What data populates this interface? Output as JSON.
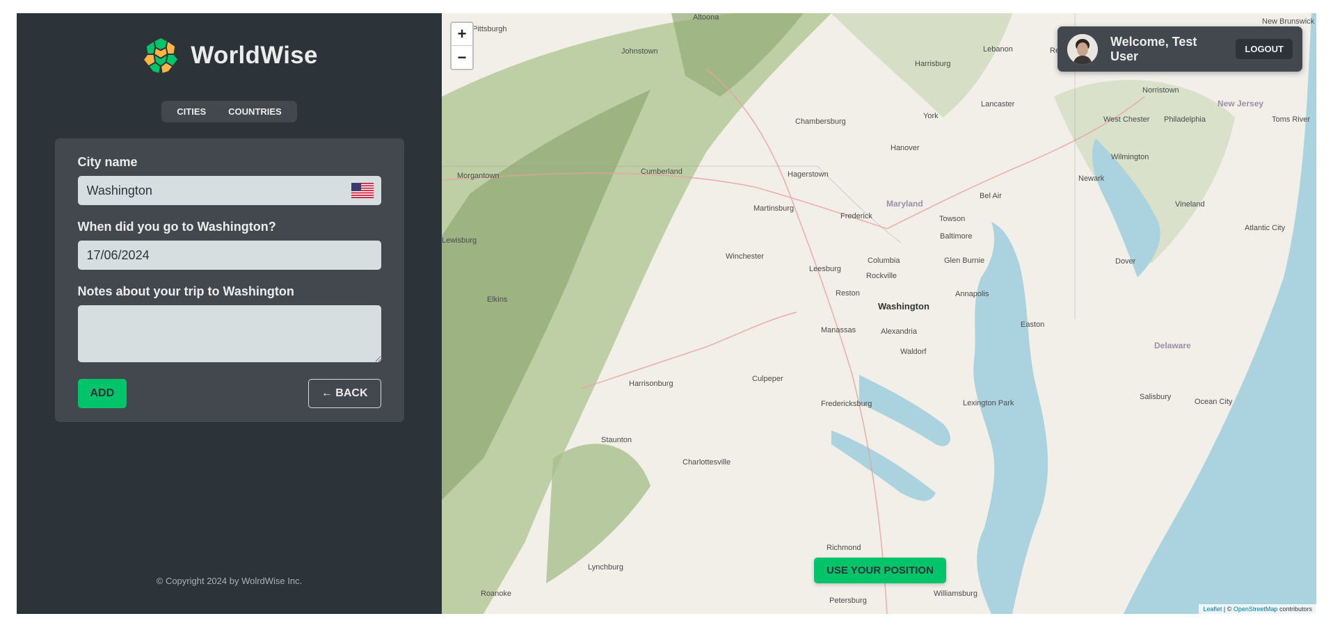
{
  "app": {
    "name": "WorldWise"
  },
  "nav": {
    "items": [
      "Cities",
      "Countries"
    ]
  },
  "form": {
    "city_label": "City name",
    "city_value": "Washington",
    "date_label": "When did you go to Washington?",
    "date_value": "17/06/2024",
    "notes_label": "Notes about your trip to Washington",
    "notes_value": "",
    "add_label": "Add",
    "back_label": "← Back"
  },
  "footer": {
    "copyright": "© Copyright 2024 by WolrdWise Inc."
  },
  "user": {
    "welcome": "Welcome, Test User",
    "logout_label": "Logout"
  },
  "map": {
    "zoom_in": "+",
    "zoom_out": "−",
    "use_position_label": "Use your position",
    "attribution": {
      "leaflet": "Leaflet",
      "osm": "OpenStreetMap",
      "suffix": "contributors",
      "sep": "| ©"
    },
    "places": [
      {
        "name": "Altoona"
      },
      {
        "name": "Pittsburgh"
      },
      {
        "name": "Johnstown"
      },
      {
        "name": "Harrisburg"
      },
      {
        "name": "Lebanon"
      },
      {
        "name": "Reading"
      },
      {
        "name": "New Brunswick"
      },
      {
        "name": "Norristown"
      },
      {
        "name": "Lancaster"
      },
      {
        "name": "New Jersey"
      },
      {
        "name": "West Chester"
      },
      {
        "name": "Philadelphia"
      },
      {
        "name": "Toms River"
      },
      {
        "name": "Chambersburg"
      },
      {
        "name": "York"
      },
      {
        "name": "Hanover"
      },
      {
        "name": "Wilmington"
      },
      {
        "name": "Morgantown"
      },
      {
        "name": "Cumberland"
      },
      {
        "name": "Hagerstown"
      },
      {
        "name": "Newark"
      },
      {
        "name": "Maryland"
      },
      {
        "name": "Martinsburg"
      },
      {
        "name": "Frederick"
      },
      {
        "name": "Bel Air"
      },
      {
        "name": "Vineland"
      },
      {
        "name": "Towson"
      },
      {
        "name": "Baltimore"
      },
      {
        "name": "Atlantic City"
      },
      {
        "name": "Winchester"
      },
      {
        "name": "Columbia"
      },
      {
        "name": "Glen Burnie"
      },
      {
        "name": "Dover"
      },
      {
        "name": "Leesburg"
      },
      {
        "name": "Rockville"
      },
      {
        "name": "Elkins"
      },
      {
        "name": "Reston"
      },
      {
        "name": "Annapolis"
      },
      {
        "name": "Washington"
      },
      {
        "name": "Manassas"
      },
      {
        "name": "Alexandria"
      },
      {
        "name": "Easton"
      },
      {
        "name": "Delaware"
      },
      {
        "name": "Waldorf"
      },
      {
        "name": "Harrisonburg"
      },
      {
        "name": "Culpeper"
      },
      {
        "name": "Salisbury"
      },
      {
        "name": "Fredericksburg"
      },
      {
        "name": "Lexington Park"
      },
      {
        "name": "Ocean City"
      },
      {
        "name": "Staunton"
      },
      {
        "name": "Charlottesville"
      },
      {
        "name": "Richmond"
      },
      {
        "name": "Lynchburg"
      },
      {
        "name": "Williamsburg"
      },
      {
        "name": "Roanoke"
      },
      {
        "name": "Petersburg"
      },
      {
        "name": "Lewisburg"
      }
    ]
  }
}
